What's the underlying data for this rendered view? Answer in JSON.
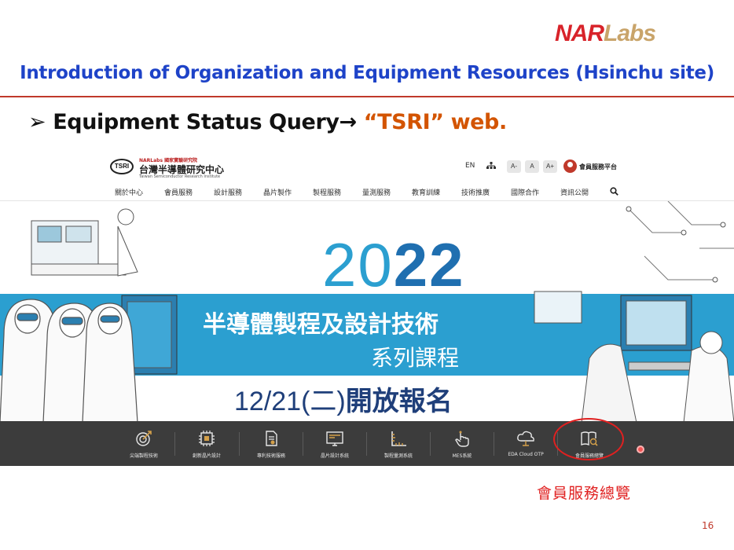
{
  "slide": {
    "logo_nar": "NAR",
    "logo_labs": "Labs",
    "title": "Introduction of Organization and Equipment Resources (Hsinchu site)",
    "bullet_marker": "➢",
    "bullet_text": "Equipment Status Query→ ",
    "bullet_accent": "“TSRI” web.",
    "callout": "會員服務總覽",
    "page_number": "16"
  },
  "site": {
    "logo_text": "TSRI",
    "org_small": "NARLabs 國家實驗研究院",
    "org_name": "台灣半導體研究中心",
    "org_english": "Taiwan Semiconductor Research Institute",
    "lang": "EN",
    "font_sizes": [
      "A-",
      "A",
      "A+"
    ],
    "member_portal": "會員服務平台",
    "nav": [
      "關於中心",
      "會員服務",
      "設計服務",
      "晶片製作",
      "製程服務",
      "量測服務",
      "教育訓練",
      "技術推廣",
      "國際合作",
      "資訊公開"
    ],
    "banner": {
      "year_thin": "20",
      "year_bold": "22",
      "line1": "半導體製程及設計技術",
      "line2": "系列課程",
      "date": "12/21(二)",
      "date_bold": "開放報名"
    },
    "services": [
      {
        "label": "尖端製程技術",
        "icon": "target-icon"
      },
      {
        "label": "創新晶片設計",
        "icon": "chip-icon"
      },
      {
        "label": "專利技術服務",
        "icon": "document-icon"
      },
      {
        "label": "晶片設計系統",
        "icon": "monitor-icon"
      },
      {
        "label": "製程量測系統",
        "icon": "ruler-icon"
      },
      {
        "label": "MES系統",
        "icon": "hand-pointer-icon"
      },
      {
        "label": "EDA Cloud OTP",
        "icon": "cloud-icon"
      },
      {
        "label": "會員服務總覽",
        "icon": "book-search-icon"
      }
    ]
  }
}
